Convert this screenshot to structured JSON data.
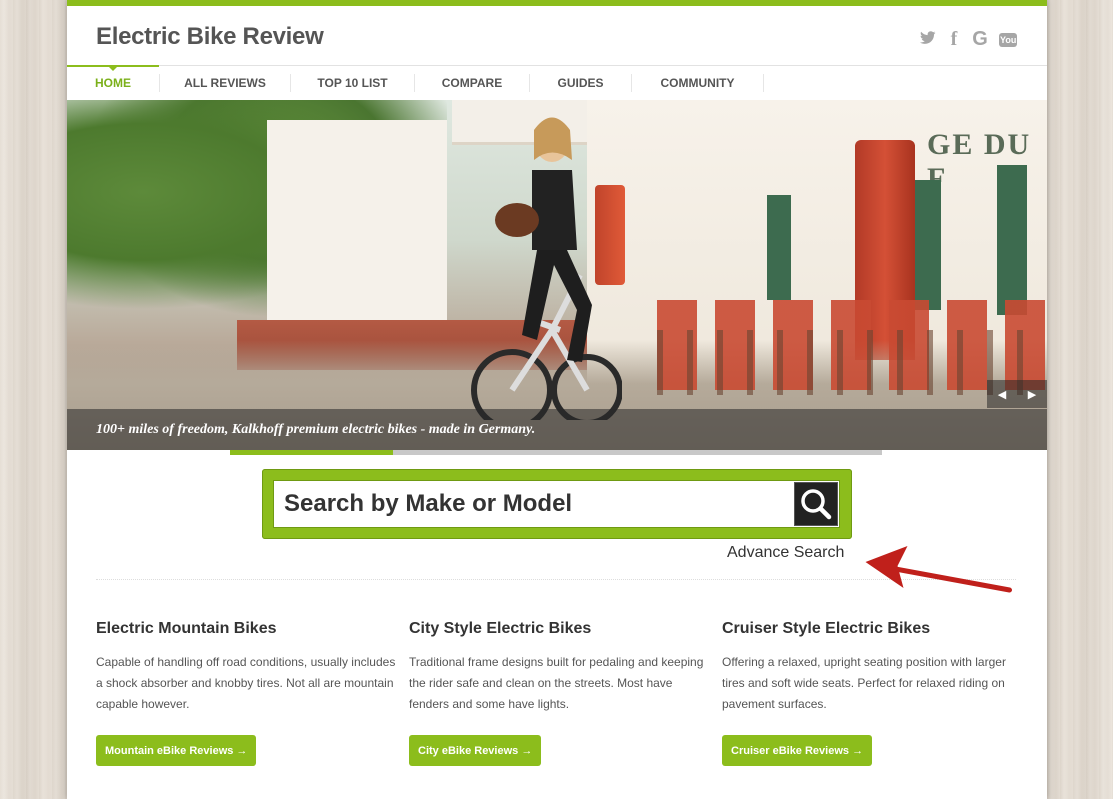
{
  "site": {
    "title": "Electric Bike Review"
  },
  "social": [
    "twitter-icon",
    "facebook-icon",
    "google-icon",
    "youtube-icon"
  ],
  "nav": {
    "items": [
      {
        "label": "HOME",
        "active": true
      },
      {
        "label": "ALL REVIEWS"
      },
      {
        "label": "TOP 10 LIST"
      },
      {
        "label": "COMPARE"
      },
      {
        "label": "GUIDES"
      },
      {
        "label": "COMMUNITY"
      }
    ]
  },
  "hero": {
    "caption": "100+ miles of freedom, Kalkhoff premium electric bikes - made in Germany.",
    "sign": "GE DU F",
    "slide_prev": "◀",
    "slide_next": "▶",
    "progress": 0.25
  },
  "search": {
    "placeholder": "Search by Make or Model",
    "advance_link": "Advance Search"
  },
  "categories": [
    {
      "title": "Electric Mountain Bikes",
      "description": "Capable of handling off road conditions, usually includes a shock absorber and knobby tires. Not all are mountain capable however.",
      "button": "Mountain eBike Reviews →"
    },
    {
      "title": "City Style Electric Bikes",
      "description": "Traditional frame designs built for pedaling and keeping the rider safe and clean on the streets. Most have fenders and some have lights.",
      "button": "City eBike Reviews →"
    },
    {
      "title": "Cruiser Style Electric Bikes",
      "description": "Offering a relaxed, upright seating position with larger tires and soft wide seats. Perfect for relaxed riding on pavement surfaces.",
      "button": "Cruiser eBike Reviews →"
    }
  ],
  "colors": {
    "accent": "#8cbd1c",
    "annotation_arrow": "#c0201b"
  }
}
